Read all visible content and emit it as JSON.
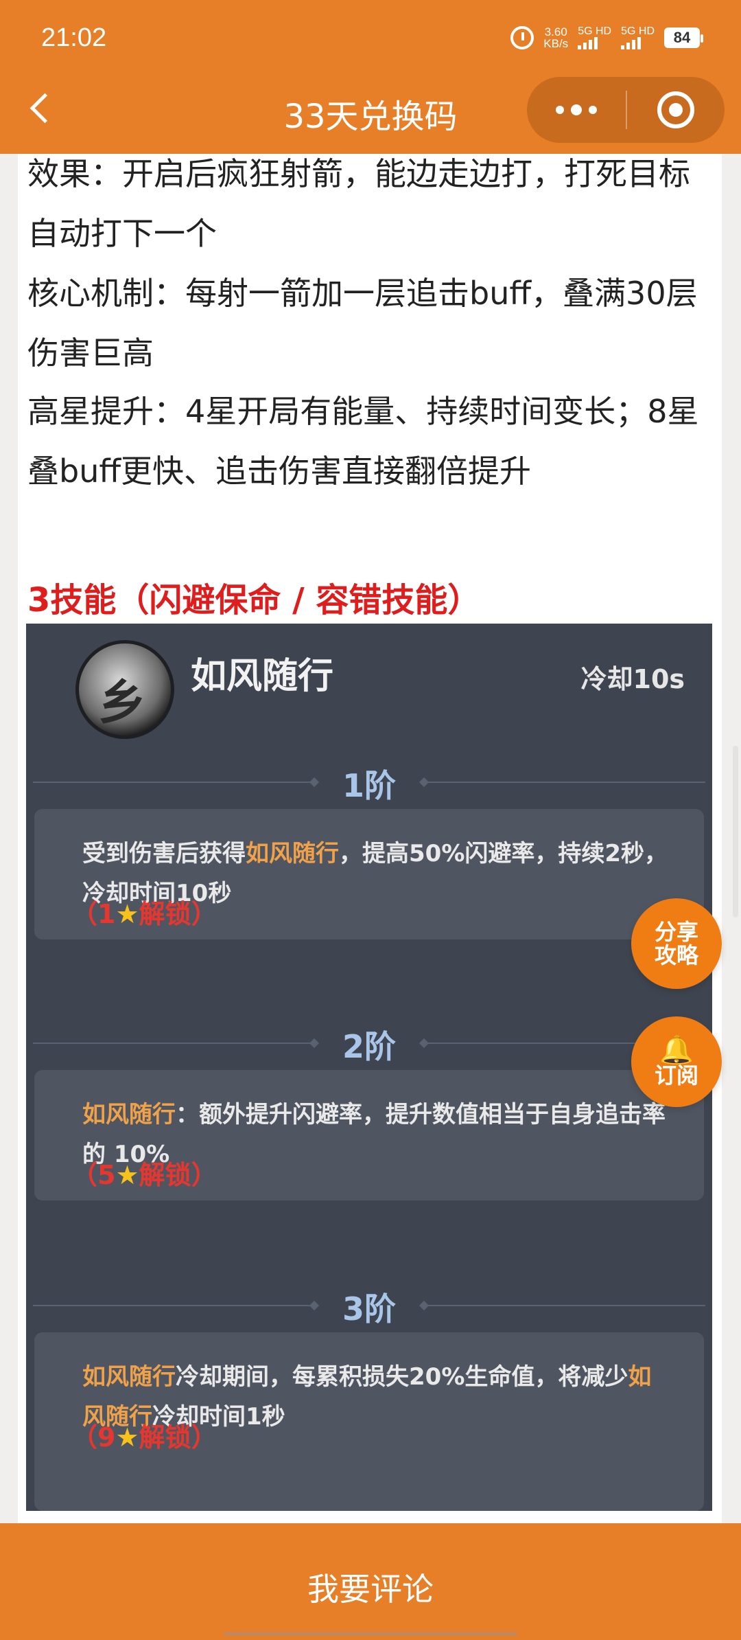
{
  "status_bar": {
    "time": "21:02",
    "speed_value": "3.60",
    "speed_unit": "KB/s",
    "network1": "5G HD",
    "network2": "5G HD",
    "battery": "84"
  },
  "header": {
    "title": "33天兑换码"
  },
  "article": {
    "paragraphs": [
      "效果：开启后疯狂射箭，能边走边打，打死目标自动打下一个",
      "核心机制：每射一箭加一层追击buff，叠满30层伤害巨高",
      "高星提升：4星开局有能量、持续时间变长；8星叠buff更快、追击伤害直接翻倍提升"
    ],
    "section_title": "3技能（闪避保命 / 容错技能）"
  },
  "skill": {
    "name": "如风随行",
    "cooldown": "冷却10s",
    "tiers": [
      {
        "label": "1阶",
        "text_a": "受到伤害后获得",
        "highlight": "如风随行",
        "text_b": "，提高50%闪避率，持续2秒，冷却时间10秒",
        "unlock_num": "1",
        "unlock_text": "解锁"
      },
      {
        "label": "2阶",
        "highlight": "如风随行",
        "text_b": "：额外提升闪避率，提升数值相当于自身追击率的 10%",
        "unlock_num": "5",
        "unlock_text": "解锁"
      },
      {
        "label": "3阶",
        "highlight": "如风随行",
        "text_b": "冷却期间，每累积损失20%生命值，将减少",
        "highlight2": "如风随行",
        "text_c": "冷却时间1秒",
        "unlock_num": "9",
        "unlock_text": "解锁"
      }
    ]
  },
  "floating": {
    "share_line1": "分享",
    "share_line2": "攻略",
    "subscribe": "订阅"
  },
  "footer": {
    "comment": "我要评论"
  },
  "colors": {
    "brand": "#e67f27",
    "section_title": "#e01d1d",
    "highlight": "#f0a24a",
    "unlock": "#e5372f"
  }
}
